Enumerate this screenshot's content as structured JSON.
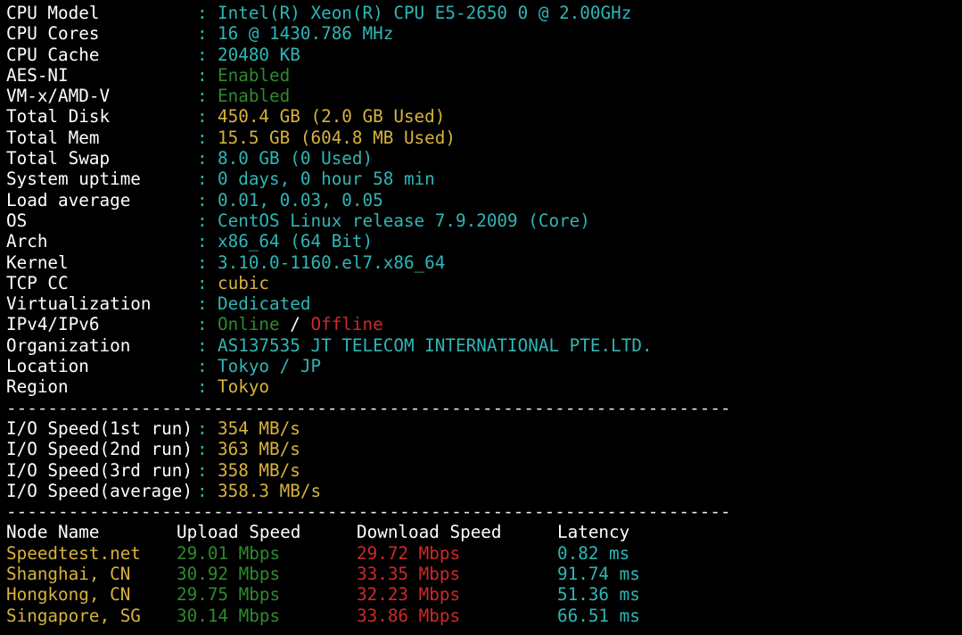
{
  "colors": {
    "background": "#000000",
    "label": "#ffffff",
    "cyan": "#2fb6b6",
    "yellow": "#d8b23c",
    "green": "#2f8a2f",
    "red": "#cc2a2a"
  },
  "separator": ":",
  "sysinfo": [
    {
      "label": "CPU Model",
      "value": "Intel(R) Xeon(R) CPU E5-2650 0 @ 2.00GHz",
      "color": "cyan"
    },
    {
      "label": "CPU Cores",
      "value": "16 @ 1430.786 MHz",
      "color": "cyan"
    },
    {
      "label": "CPU Cache",
      "value": "20480 KB",
      "color": "cyan"
    },
    {
      "label": "AES-NI",
      "value": "Enabled",
      "color": "green"
    },
    {
      "label": "VM-x/AMD-V",
      "value": "Enabled",
      "color": "green"
    },
    {
      "label": "Total Disk",
      "value": "450.4 GB (2.0 GB Used)",
      "color": "yellow"
    },
    {
      "label": "Total Mem",
      "value": "15.5 GB (604.8 MB Used)",
      "color": "yellow"
    },
    {
      "label": "Total Swap",
      "value": "8.0 GB (0 Used)",
      "color": "cyan"
    },
    {
      "label": "System uptime",
      "value": "0 days, 0 hour 58 min",
      "color": "cyan"
    },
    {
      "label": "Load average",
      "value": "0.01, 0.03, 0.05",
      "color": "cyan"
    },
    {
      "label": "OS",
      "value": "CentOS Linux release 7.9.2009 (Core)",
      "color": "cyan"
    },
    {
      "label": "Arch",
      "value": "x86_64 (64 Bit)",
      "color": "cyan"
    },
    {
      "label": "Kernel",
      "value": "3.10.0-1160.el7.x86_64",
      "color": "cyan"
    },
    {
      "label": "TCP CC",
      "value": "cubic",
      "color": "yellow"
    },
    {
      "label": "Virtualization",
      "value": "Dedicated",
      "color": "cyan"
    }
  ],
  "ip_status": {
    "label": "IPv4/IPv6",
    "ipv4": "Online",
    "slash": " / ",
    "ipv6": "Offline"
  },
  "geo": [
    {
      "label": "Organization",
      "value": "AS137535 JT TELECOM INTERNATIONAL PTE.LTD.",
      "color": "cyan"
    },
    {
      "label": "Location",
      "value": "Tokyo / JP",
      "color": "cyan"
    },
    {
      "label": "Region",
      "value": "Tokyo",
      "color": "yellow"
    }
  ],
  "divider": "----------------------------------------------------------------------",
  "io": [
    {
      "label": "I/O Speed(1st run)",
      "value": "354 MB/s"
    },
    {
      "label": "I/O Speed(2nd run)",
      "value": "363 MB/s"
    },
    {
      "label": "I/O Speed(3rd run)",
      "value": "358 MB/s"
    },
    {
      "label": "I/O Speed(average)",
      "value": "358.3 MB/s"
    }
  ],
  "speedtest": {
    "headers": {
      "node": "Node Name",
      "upload": "Upload Speed",
      "download": "Download Speed",
      "latency": "Latency"
    },
    "rows": [
      {
        "node": "Speedtest.net",
        "upload": "29.01 Mbps",
        "download": "29.72 Mbps",
        "latency": "0.82 ms"
      },
      {
        "node": "Shanghai, CN",
        "upload": "30.92 Mbps",
        "download": "33.35 Mbps",
        "latency": "91.74 ms"
      },
      {
        "node": "Hongkong, CN",
        "upload": "29.75 Mbps",
        "download": "32.23 Mbps",
        "latency": "51.36 ms"
      },
      {
        "node": "Singapore, SG",
        "upload": "30.14 Mbps",
        "download": "33.86 Mbps",
        "latency": "66.51 ms"
      }
    ]
  }
}
